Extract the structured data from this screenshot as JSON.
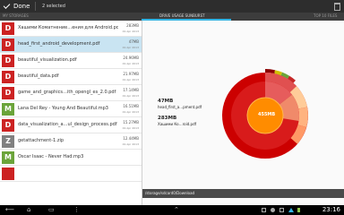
{
  "actionbar": {
    "done_label": "Done",
    "selected_label": "2 selected"
  },
  "tabs": {
    "left": "MY STORAGES",
    "center": "DRIVE USAGE SUNBURST",
    "right": "TOP 10 FILES"
  },
  "files": [
    {
      "icon": "D",
      "type": "pdf",
      "name": "Хашими Коматнение…ения для Android.pdf",
      "size": "283MB",
      "date": "19 Apr 2013",
      "selected": false
    },
    {
      "icon": "D",
      "type": "pdf",
      "name": "head_first_android_development.pdf",
      "size": "47MB",
      "date": "19 Apr 2013",
      "selected": true
    },
    {
      "icon": "D",
      "type": "pdf",
      "name": "beautiful_visualization.pdf",
      "size": "24.96MB",
      "date": "19 Apr 2013",
      "selected": false
    },
    {
      "icon": "D",
      "type": "pdf",
      "name": "beautiful_data.pdf",
      "size": "21.97MB",
      "date": "19 Apr 2013",
      "selected": false
    },
    {
      "icon": "D",
      "type": "pdf",
      "name": "game_and_graphics…ith_opengl_es_2.0.pdf",
      "size": "17.14MB",
      "date": "19 Apr 2013",
      "selected": false
    },
    {
      "icon": "M",
      "type": "mp3",
      "name": "Lana Del Rey - Young And Beautiful.mp3",
      "size": "16.51MB",
      "date": "19 Apr 2013",
      "selected": false
    },
    {
      "icon": "D",
      "type": "pdf",
      "name": "data_visualization_a…ul_design_process.pdf",
      "size": "15.27MB",
      "date": "19 Apr 2013",
      "selected": false
    },
    {
      "icon": "Z",
      "type": "zip",
      "name": "getattachment-1.zip",
      "size": "12.44MB",
      "date": "19 Apr 2013",
      "selected": false
    },
    {
      "icon": "M",
      "type": "mp3",
      "name": "Oscar Isaac - Never Had.mp3",
      "size": "",
      "date": "",
      "selected": false
    }
  ],
  "sunburst": {
    "center_label": "455MB",
    "label_a_size": "47MB",
    "label_a_name": "head_first_a…pment.pdf",
    "label_b_size": "283MB",
    "label_b_name": "Хашими Ко…roid.pdf"
  },
  "path": "/storage/sdcard0/Download",
  "status": {
    "time": "23:16"
  },
  "colors": {
    "accent": "#33b5e5",
    "pdf": "#cc2222",
    "mp3": "#6ba43a",
    "zip": "#808080",
    "sunburst_center": "#ff8c00",
    "sunburst_main": "#cc0000"
  }
}
